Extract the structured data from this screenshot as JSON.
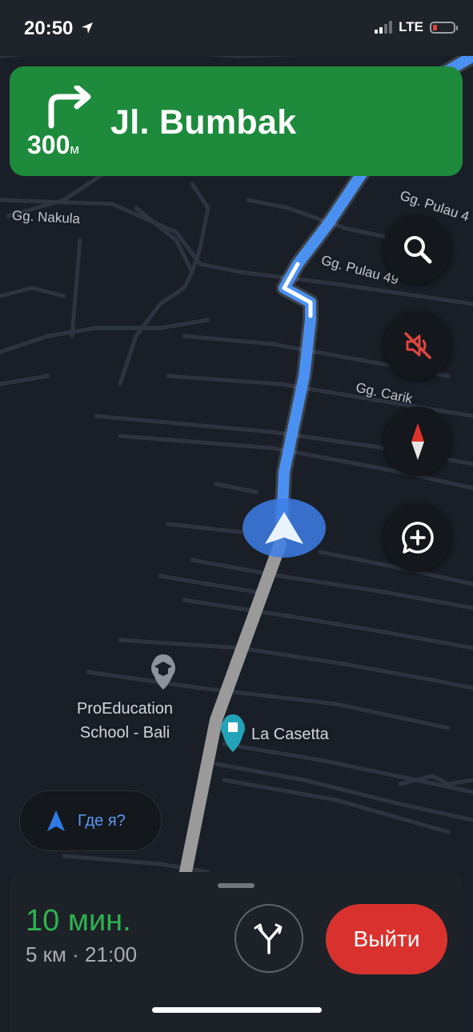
{
  "status": {
    "time": "20:50",
    "network": "LTE",
    "battery_color": "#e5423a"
  },
  "banner": {
    "distance": "300",
    "distance_unit": "м",
    "street": "Jl. Bumbak",
    "color": "#1e8a3c"
  },
  "map": {
    "road_labels": [
      "Gg. Nakula",
      "Gg. Pulau 4",
      "Gg. Pulau 49",
      "Gg. Carik"
    ],
    "pois": [
      {
        "name": "ProEducation School - Bali",
        "icon": "school-icon"
      },
      {
        "name": "La Casetta",
        "icon": "place-icon"
      }
    ],
    "route_color": "#4a90f0",
    "traveled_color": "#9a9a9a"
  },
  "map_buttons": [
    {
      "name": "search",
      "icon": "search-icon"
    },
    {
      "name": "mute",
      "icon": "sound-off-icon",
      "color": "#e0453f"
    },
    {
      "name": "compass",
      "icon": "compass-icon"
    },
    {
      "name": "report",
      "icon": "add-report-icon"
    }
  ],
  "where_button": {
    "label": "Где я?"
  },
  "bottom": {
    "eta_minutes": "10 мин.",
    "details": "5 км · 21:00",
    "exit_label": "Выйти",
    "eta_color": "#2eb34f",
    "exit_color": "#d9322e"
  }
}
